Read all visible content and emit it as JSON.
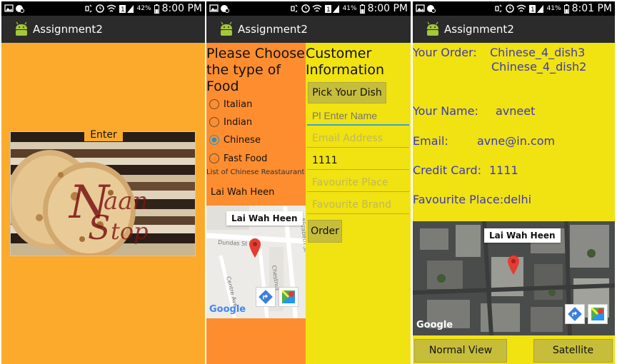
{
  "status_bars": [
    {
      "battery": "42%",
      "time": "8:00 PM"
    },
    {
      "battery": "41%",
      "time": "8:00 PM"
    },
    {
      "battery": "41%",
      "time": "8:01 PM"
    }
  ],
  "app_title": "Assignment2",
  "screen1": {
    "enter_label": "Enter",
    "logo_text": "Naan Stop"
  },
  "screen2": {
    "choose_title": "Please Choose the type of Food",
    "options": [
      "Italian",
      "Indian",
      "Chinese",
      "Fast Food"
    ],
    "selected": "Chinese",
    "list_caption": "List of Chinese Reastaurant",
    "restaurant": "Lai Wah Heen",
    "map": {
      "marker_label": "Lai Wah Heen",
      "street_dundas": "Dundas St",
      "street_elizabeth": "Elizabeth St",
      "street_centre": "Centre Ave",
      "street_chestnut": "Chestnut",
      "google_logo": "Google"
    },
    "customer_title": "Customer Information",
    "pick_dish_label": "Pick Your Dish",
    "name_placeholder": "Pl Enter Name",
    "email_placeholder": "Email Address",
    "credit_value": "1111",
    "place_placeholder": "Favourite Place",
    "brand_placeholder": "Favourite Brand",
    "order_label": "Order"
  },
  "screen3": {
    "order_label": "Your Order:",
    "order_items": [
      "Chinese_4_dish3",
      "Chinese_4_dish2"
    ],
    "name_label": "Your Name:",
    "name_value": "avneet",
    "email_label": "Email:",
    "email_value": "avne@in.com",
    "card_label": "Credit Card:",
    "card_value": "1111",
    "place_text": "Favourite Place:delhi",
    "map": {
      "marker_label": "Lai Wah Heen",
      "google_logo": "Google"
    },
    "normal_view_label": "Normal View",
    "satellite_label": "Satellite"
  },
  "colors": {
    "screen1_bg": "#fcaa2b",
    "food_panel_bg": "#fe8d2f",
    "customer_panel_bg": "#f1e211",
    "info_text": "#3b3ab5",
    "button_bg": "#c6bd3a",
    "radio_selected": "#2196c4"
  },
  "icons": [
    "gallery-icon",
    "notification-icon",
    "vibrate-icon",
    "alarm-icon",
    "wifi-icon",
    "sim-icon",
    "signal-icon",
    "battery-icon",
    "android-app-icon",
    "map-pin-icon",
    "directions-icon",
    "maps-app-icon"
  ]
}
